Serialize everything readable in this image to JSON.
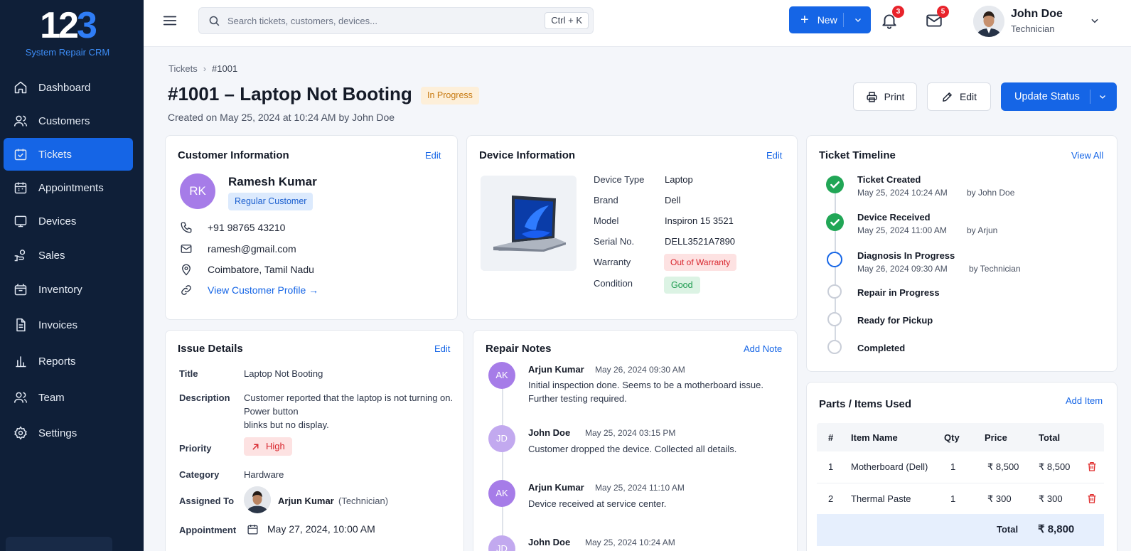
{
  "app": {
    "logo_text": "123",
    "subtitle": "System Repair CRM"
  },
  "sidebar": {
    "items": [
      {
        "label": "Dashboard",
        "icon": "home-icon"
      },
      {
        "label": "Customers",
        "icon": "users-icon"
      },
      {
        "label": "Tickets",
        "icon": "ticket-icon",
        "active": true
      },
      {
        "label": "Appointments",
        "icon": "calendar-icon"
      },
      {
        "label": "Devices",
        "icon": "tablet-icon"
      },
      {
        "label": "Sales",
        "icon": "hand-coin-icon"
      },
      {
        "label": "Inventory",
        "icon": "box-icon"
      },
      {
        "label": "Invoices",
        "icon": "document-icon"
      },
      {
        "label": "Reports",
        "icon": "bar-chart-icon"
      },
      {
        "label": "Team",
        "icon": "team-icon"
      },
      {
        "label": "Settings",
        "icon": "gear-icon"
      }
    ]
  },
  "topbar": {
    "search_placeholder": "Search tickets, customers, devices...",
    "shortcut": "Ctrl + K",
    "new_label": "New",
    "notifications_count": "3",
    "messages_count": "5",
    "user_name": "John Doe",
    "user_role": "Technician"
  },
  "page": {
    "breadcrumb": [
      "Tickets",
      "#1001"
    ],
    "title": "#1001 – Laptop Not Booting",
    "status": "In Progress",
    "created": "Created on May 25, 2024 at 10:24 AM by John Doe",
    "actions": {
      "print": "Print",
      "edit": "Edit",
      "update_status": "Update Status"
    }
  },
  "customer": {
    "title": "Customer Information",
    "edit": "Edit",
    "initials": "RK",
    "name": "Ramesh Kumar",
    "type": "Regular Customer",
    "phone": "+91 98765 43210",
    "email": "ramesh@gmail.com",
    "location": "Coimbatore, Tamil Nadu",
    "profile_link": "View Customer Profile →"
  },
  "device": {
    "title": "Device Information",
    "edit": "Edit",
    "fields": [
      {
        "label": "Device Type",
        "value": "Laptop"
      },
      {
        "label": "Brand",
        "value": "Dell"
      },
      {
        "label": "Model",
        "value": "Inspiron 15 3521"
      },
      {
        "label": "Serial No.",
        "value": "DELL3521A7890"
      },
      {
        "label": "Warranty",
        "value": "Out of Warranty"
      },
      {
        "label": "Condition",
        "value": "Good"
      }
    ]
  },
  "timeline": {
    "title": "Ticket Timeline",
    "view_all": "View All",
    "steps": [
      {
        "title": "Ticket Created",
        "date": "May 25, 2024 10:24 AM",
        "by": "by John Doe",
        "state": "done"
      },
      {
        "title": "Device Received",
        "date": "May 25, 2024 11:00 AM",
        "by": "by Arjun",
        "state": "done"
      },
      {
        "title": "Diagnosis In Progress",
        "date": "May 26, 2024 09:30 AM",
        "by": "by Technician",
        "state": "current"
      },
      {
        "title": "Repair in Progress",
        "state": "todo"
      },
      {
        "title": "Ready for Pickup",
        "state": "todo"
      },
      {
        "title": "Completed",
        "state": "todo"
      }
    ]
  },
  "issue": {
    "title": "Issue Details",
    "edit": "Edit",
    "labels": {
      "title": "Title",
      "description": "Description",
      "priority": "Priority",
      "category": "Category",
      "assigned": "Assigned To",
      "appointment": "Appointment"
    },
    "values": {
      "title": "Laptop Not Booting",
      "description_1": "Customer reported that the laptop is not turning on.",
      "description_2": "Power button",
      "description_3": "blinks but no display.",
      "priority": "High",
      "category": "Hardware",
      "assigned_name": "Arjun Kumar",
      "assigned_role": "(Technician)",
      "appointment": "May 27, 2024, 10:00 AM"
    }
  },
  "notes": {
    "title": "Repair Notes",
    "add": "Add Note",
    "items": [
      {
        "initials": "AK",
        "author": "Arjun Kumar",
        "date": "May 26, 2024 09:30 AM",
        "text": "Initial inspection done. Seems to be a motherboard issue. Further testing required."
      },
      {
        "initials": "JD",
        "author": "John Doe",
        "date": "May 25, 2024 03:15 PM",
        "text": "Customer dropped the device. Collected all details."
      },
      {
        "initials": "AK",
        "author": "Arjun Kumar",
        "date": "May 25, 2024 11:10 AM",
        "text": "Device received at service center."
      },
      {
        "initials": "JD",
        "author": "John Doe",
        "date": "May 25, 2024 10:24 AM",
        "text": ""
      }
    ]
  },
  "parts": {
    "title": "Parts / Items Used",
    "add": "Add Item",
    "headers": [
      "#",
      "Item Name",
      "Qty",
      "Price",
      "Total"
    ],
    "rows": [
      [
        "1",
        "Motherboard (Dell)",
        "1",
        "₹ 8,500",
        "₹ 8,500"
      ],
      [
        "2",
        "Thermal Paste",
        "1",
        "₹ 300",
        "₹ 300"
      ]
    ],
    "total_label": "Total",
    "total_value": "₹ 8,800"
  },
  "colors": {
    "accent": "#1565e6",
    "sidebar": "#0f1f38",
    "success": "#21a656",
    "danger": "#d8262e",
    "warning": "#c77a12"
  }
}
